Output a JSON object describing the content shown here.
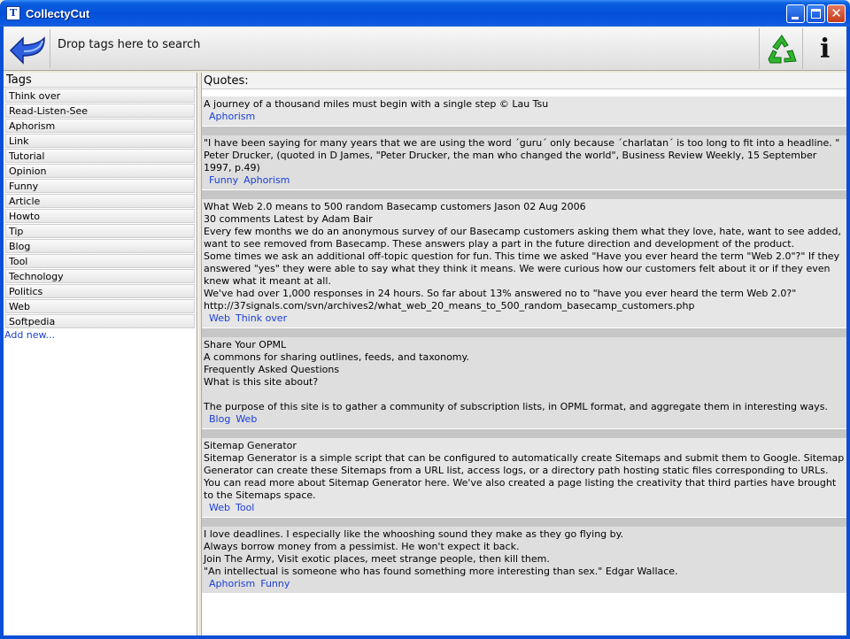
{
  "window": {
    "title": "CollectyCut",
    "app_icon_letter": "T"
  },
  "toolbar": {
    "back_icon": "blue-back-arrow-icon",
    "drop_label": "Drop tags here to search",
    "recycle_icon": "recycle-icon",
    "info_icon": "info-icon",
    "info_glyph": "i"
  },
  "tags": {
    "header": "Tags",
    "items": [
      "Think over",
      "Read-Listen-See",
      "Aphorism",
      "Link",
      "Tutorial",
      "Opinion",
      "Funny",
      "Article",
      "Howto",
      "Tip",
      "Blog",
      "Tool",
      "Technology",
      "Politics",
      "Web",
      "Softpedia"
    ],
    "add_new": "Add new..."
  },
  "quotes": {
    "header": "Quotes:",
    "items": [
      {
        "text": "A journey of a thousand miles must begin with a single step © Lau Tsu",
        "tags": [
          "Aphorism"
        ]
      },
      {
        "text": "\"I have been saying for many years that we are using the word ´guru´ only because ´charlatan´ is too long to fit into a headline. \"\nPeter Drucker, (quoted in D James, \"Peter Drucker, the man who changed the world\", Business Review Weekly, 15 September 1997, p.49)",
        "tags": [
          "Funny",
          "Aphorism"
        ]
      },
      {
        "text": "What Web 2.0 means to 500 random Basecamp customers Jason 02 Aug 2006\n30 comments Latest by Adam Bair\nEvery few months we do an anonymous survey of our Basecamp customers asking them what they love, hate, want to see added, want to see removed from Basecamp. These answers play a part in the future direction and development of the product.\nSome times we ask an additional off-topic question for fun. This time we asked \"Have you ever heard the term \"Web 2.0\"?\" If they answered \"yes\" they were able to say what they think it means. We were curious how our customers felt about it or if they even knew what it meant at all.\nWe've had over 1,000 responses in 24 hours. So far about 13% answered no to \"have you ever heard the term Web 2.0?\"\nhttp://37signals.com/svn/archives2/what_web_20_means_to_500_random_basecamp_customers.php",
        "tags": [
          "Web",
          "Think over"
        ]
      },
      {
        "text": "Share Your OPML\nA commons for sharing outlines, feeds, and taxonomy.\nFrequently Asked Questions\nWhat is this site about?\n\nThe purpose of this site is to gather a community of subscription lists, in OPML format, and aggregate them in interesting ways.",
        "tags": [
          "Blog",
          "Web"
        ]
      },
      {
        "text": "Sitemap Generator\nSitemap Generator is a simple script that can be configured to automatically create Sitemaps and submit them to Google. Sitemap Generator can create these Sitemaps from a URL list, access logs, or a directory path hosting static files corresponding to URLs. You can read more about Sitemap Generator here. We've also created a page listing the creativity that third parties have brought to the Sitemaps space.",
        "tags": [
          "Web",
          "Tool"
        ]
      },
      {
        "text": "I love deadlines. I especially like the whooshing sound they make as they go flying by.\nAlways borrow money from a pessimist. He won't expect it back.\nJoin The Army, Visit exotic places, meet strange people, then kill them.\n\"An intellectual is someone who has found something more interesting than sex.\" Edgar Wallace.",
        "tags": [
          "Aphorism",
          "Funny"
        ]
      }
    ]
  }
}
